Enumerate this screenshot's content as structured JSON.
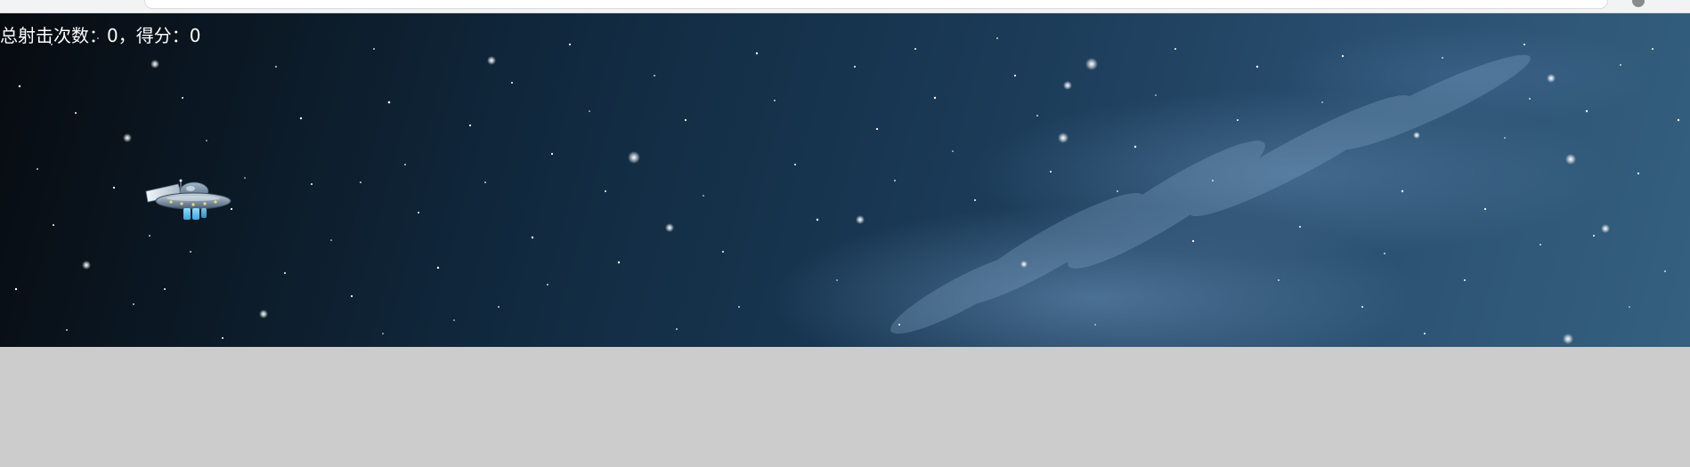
{
  "hud": {
    "shots_label": "总射击次数",
    "shots": "0",
    "score_label": "得分",
    "score": "0"
  },
  "player": {
    "icon": "ufo-icon"
  },
  "colors": {
    "sky_dark": "#070b10",
    "sky_light": "#35607f",
    "below_stage": "#cccccc",
    "text": "#ffffff"
  }
}
